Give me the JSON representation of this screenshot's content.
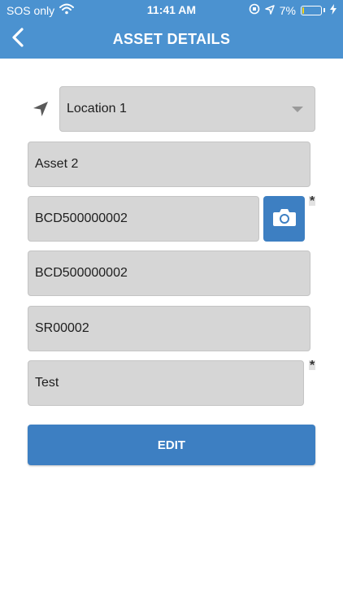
{
  "status_bar": {
    "carrier": "SOS only",
    "time": "11:41 AM",
    "battery_percent": "7%",
    "battery_level": 0.07,
    "icons": [
      "wifi-icon",
      "orientation-lock-icon",
      "location-arrow-icon",
      "battery-icon",
      "charging-bolt-icon"
    ]
  },
  "header": {
    "title": "ASSET DETAILS",
    "back_icon": "chevron-left-icon"
  },
  "form": {
    "location": {
      "icon": "navigation-arrow-icon",
      "value": "Location 1"
    },
    "asset_name": {
      "value": "Asset 2"
    },
    "barcode": {
      "value": "BCD500000002",
      "required_mark": "*",
      "scan_icon": "camera-icon"
    },
    "tag": {
      "value": "BCD500000002"
    },
    "serial": {
      "value": "SR00002"
    },
    "description": {
      "value": "Test",
      "required_mark": "*"
    }
  },
  "actions": {
    "edit_label": "EDIT"
  },
  "colors": {
    "header": "#4b92d0",
    "button": "#3d7fc2",
    "field_bg": "#d6d6d6",
    "battery_low": "#f3d21a"
  }
}
